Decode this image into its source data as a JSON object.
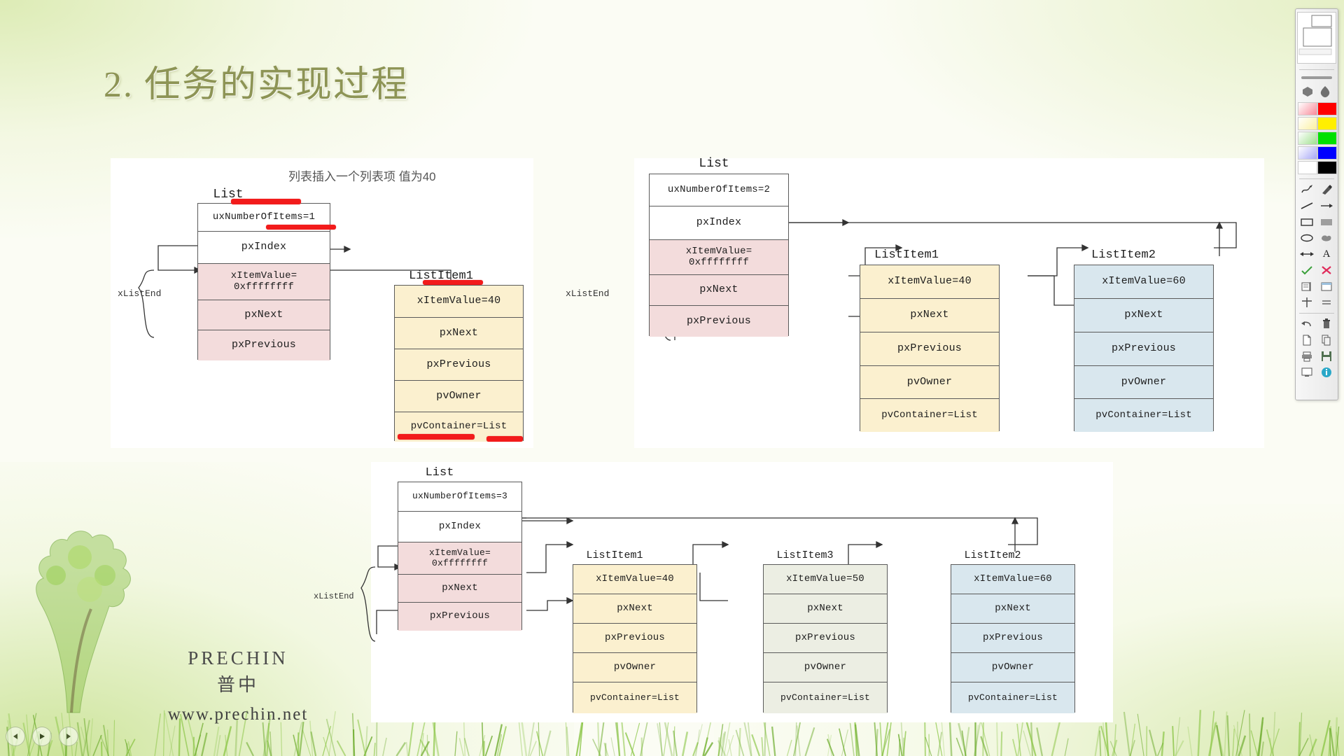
{
  "slide": {
    "title": "2. 任务的实现过程",
    "caption_top": "列表插入一个列表项 值为40"
  },
  "brand": {
    "name_en": "PRECHIN",
    "name_cn": "普中",
    "url": "www.prechin.net"
  },
  "labels": {
    "list": "List",
    "list_item1": "ListItem1",
    "list_item2": "ListItem2",
    "list_item3": "ListItem3",
    "x_list_end": "xListEnd"
  },
  "fields": {
    "ux_number_1": "uxNumberOfItems=1",
    "ux_number_2": "uxNumberOfItems=2",
    "ux_number_3": "uxNumberOfItems=3",
    "px_index": "pxIndex",
    "x_item_value_end": "xItemValue=\n0xffffffff",
    "x_item_value_end_l1": "xItemValue=",
    "x_item_value_end_l2": "0xffffffff",
    "px_next": "pxNext",
    "px_previous": "pxPrevious",
    "pv_owner": "pvOwner",
    "pv_container": "pvContainer=List",
    "x_item_value_40": "xItemValue=40",
    "x_item_value_50": "xItemValue=50",
    "x_item_value_60": "xItemValue=60"
  },
  "diagrams": [
    {
      "id": "diagram-1",
      "list": {
        "title": "List",
        "rows": [
          "uxNumberOfItems=1",
          "pxIndex",
          "xItemValue=0xffffffff",
          "pxNext",
          "pxPrevious"
        ]
      },
      "items": [
        {
          "title": "ListItem1",
          "rows": [
            "xItemValue=40",
            "pxNext",
            "pxPrevious",
            "pvOwner",
            "pvContainer=List"
          ],
          "color": "#fbf0cf"
        }
      ],
      "end_label": "xListEnd"
    },
    {
      "id": "diagram-2",
      "list": {
        "title": "List",
        "rows": [
          "uxNumberOfItems=2",
          "pxIndex",
          "xItemValue=0xffffffff",
          "pxNext",
          "pxPrevious"
        ]
      },
      "items": [
        {
          "title": "ListItem1",
          "rows": [
            "xItemValue=40",
            "pxNext",
            "pxPrevious",
            "pvOwner",
            "pvContainer=List"
          ],
          "color": "#fbf0cf"
        },
        {
          "title": "ListItem2",
          "rows": [
            "xItemValue=60",
            "pxNext",
            "pxPrevious",
            "pvOwner",
            "pvContainer=List"
          ],
          "color": "#d9e7ee"
        }
      ],
      "end_label": "xListEnd"
    },
    {
      "id": "diagram-3",
      "list": {
        "title": "List",
        "rows": [
          "uxNumberOfItems=3",
          "pxIndex",
          "xItemValue=0xffffffff",
          "pxNext",
          "pxPrevious"
        ]
      },
      "items": [
        {
          "title": "ListItem1",
          "rows": [
            "xItemValue=40",
            "pxNext",
            "pxPrevious",
            "pvOwner",
            "pvContainer=List"
          ],
          "color": "#fbf0cf"
        },
        {
          "title": "ListItem3",
          "rows": [
            "xItemValue=50",
            "pxNext",
            "pxPrevious",
            "pvOwner",
            "pvContainer=List"
          ],
          "color": "#eceee3"
        },
        {
          "title": "ListItem2",
          "rows": [
            "xItemValue=60",
            "pxNext",
            "pxPrevious",
            "pvOwner",
            "pvContainer=List"
          ],
          "color": "#d9e7ee"
        }
      ],
      "end_label": "xListEnd"
    }
  ],
  "colors": {
    "title": "#8d9455",
    "annotation_red": "#f21b1b",
    "list_head": "#ffffff",
    "list_end": "#f3dcdc",
    "item1": "#fbf0cf",
    "item2": "#d9e7ee",
    "item3": "#eceee3",
    "canvas": "#ffffff"
  },
  "toolbar": {
    "title": "annotation-toolbar",
    "swatches": [
      {
        "name": "pink",
        "hex": "#f98a9a"
      },
      {
        "name": "red",
        "hex": "#fe0000"
      },
      {
        "name": "lightyellow",
        "hex": "#fbf0a0"
      },
      {
        "name": "yellow",
        "hex": "#ffef00"
      },
      {
        "name": "lightgreen",
        "hex": "#9fe08e"
      },
      {
        "name": "green",
        "hex": "#00e000"
      },
      {
        "name": "lightblue",
        "hex": "#a6a6f6"
      },
      {
        "name": "blue",
        "hex": "#0000ff"
      },
      {
        "name": "white",
        "hex": "#ffffff"
      },
      {
        "name": "black",
        "hex": "#000000"
      }
    ],
    "tools": [
      "pen-icon",
      "highlighter-icon",
      "line-icon",
      "arrow-icon",
      "rectangle-icon",
      "filled-rectangle-icon",
      "ellipse-icon",
      "filled-shape-icon",
      "double-arrow-icon",
      "text-icon",
      "check-icon",
      "cross-icon",
      "notes-icon",
      "window-icon",
      "cross-hair-icon",
      "equals-icon",
      "undo-icon",
      "trash-icon",
      "new-page-icon",
      "copy-icon",
      "print-icon",
      "save-icon",
      "monitor-icon",
      "info-icon"
    ]
  },
  "media": {
    "prev_label": "prev",
    "play_label": "play",
    "next_label": "next"
  }
}
